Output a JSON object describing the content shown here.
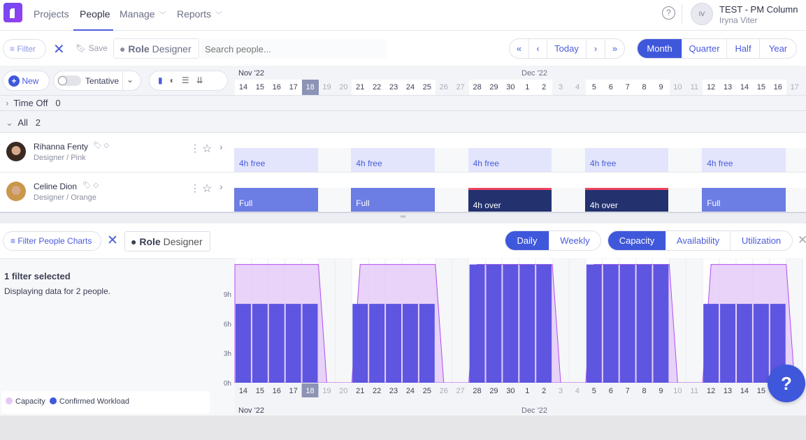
{
  "nav": {
    "items": [
      {
        "label": "Projects"
      },
      {
        "label": "People"
      },
      {
        "label": "Manage"
      },
      {
        "label": "Reports"
      }
    ],
    "active": "People"
  },
  "account": {
    "initials": "IV",
    "workspace": "TEST - PM Column",
    "user": "Iryna Viter",
    "help": "?"
  },
  "filterbar": {
    "filter_label": "Filter",
    "save_label": "Save",
    "chip_key": "Role",
    "chip_value": "Designer",
    "search_placeholder": "Search people..."
  },
  "datenav": {
    "today": "Today",
    "first": "«",
    "prev": "‹",
    "next": "›",
    "last": "»"
  },
  "views": {
    "items": [
      "Month",
      "Quarter",
      "Half",
      "Year"
    ],
    "active": "Month"
  },
  "toolbar": {
    "new_label": "New",
    "tentative_label": "Tentative"
  },
  "timeline": {
    "months": [
      "Nov '22",
      "Dec '22"
    ],
    "days": [
      14,
      15,
      16,
      17,
      18,
      19,
      20,
      21,
      22,
      23,
      24,
      25,
      26,
      27,
      28,
      29,
      30,
      1,
      2,
      3,
      4,
      5,
      6,
      7,
      8,
      9,
      10,
      11,
      12,
      13,
      14,
      15,
      16,
      17
    ],
    "weekend": [
      19,
      20,
      26,
      27,
      3,
      4,
      10,
      11,
      17
    ],
    "today": 18
  },
  "groups": [
    {
      "label": "Time Off",
      "count": "0"
    },
    {
      "label": "All",
      "count": "2"
    }
  ],
  "people": [
    {
      "name": "Rihanna Fenty",
      "role": "Designer / Pink",
      "allocations": [
        {
          "label": "4h free",
          "kind": "free"
        },
        {
          "label": "4h free",
          "kind": "free"
        },
        {
          "label": "4h free",
          "kind": "free"
        },
        {
          "label": "4h free",
          "kind": "free"
        },
        {
          "label": "4h free",
          "kind": "free"
        }
      ]
    },
    {
      "name": "Celine Dion",
      "role": "Designer / Orange",
      "allocations": [
        {
          "label": "Full",
          "kind": "full"
        },
        {
          "label": "Full",
          "kind": "full"
        },
        {
          "label": "4h over",
          "kind": "over"
        },
        {
          "label": "4h over",
          "kind": "over"
        },
        {
          "label": "Full",
          "kind": "full"
        }
      ]
    }
  ],
  "charts": {
    "filter_label": "Filter People Charts",
    "chip_key": "Role",
    "chip_value": "Designer",
    "period": {
      "items": [
        "Daily",
        "Weekly"
      ],
      "active": "Daily"
    },
    "mode": {
      "items": [
        "Capacity",
        "Availability",
        "Utilization"
      ],
      "active": "Capacity"
    },
    "summary_title": "1 filter selected",
    "summary_text": "Displaying data for 2 people."
  },
  "chart_data": {
    "type": "bar",
    "categories": [
      "14",
      "15",
      "16",
      "17",
      "18",
      "19",
      "20",
      "21",
      "22",
      "23",
      "24",
      "25",
      "26",
      "27",
      "28",
      "29",
      "30",
      "1",
      "2",
      "3",
      "4",
      "5",
      "6",
      "7",
      "8",
      "9",
      "10",
      "11",
      "12",
      "13",
      "14",
      "15",
      "16",
      "17"
    ],
    "series": [
      {
        "name": "Capacity",
        "type": "area",
        "color": "#e3c8f7",
        "values": [
          12,
          12,
          12,
          12,
          12,
          0,
          0,
          12,
          12,
          12,
          12,
          12,
          0,
          0,
          12,
          12,
          12,
          12,
          12,
          0,
          0,
          12,
          12,
          12,
          12,
          12,
          0,
          0,
          12,
          12,
          12,
          12,
          12,
          0
        ]
      },
      {
        "name": "Confirmed Workload",
        "type": "bar",
        "color": "#5e55e0",
        "values": [
          8,
          8,
          8,
          8,
          8,
          0,
          0,
          8,
          8,
          8,
          8,
          8,
          0,
          0,
          12,
          12,
          12,
          12,
          12,
          0,
          0,
          12,
          12,
          12,
          12,
          12,
          0,
          0,
          8,
          8,
          8,
          8,
          8,
          0
        ]
      }
    ],
    "yticks": [
      "0h",
      "3h",
      "6h",
      "9h"
    ],
    "ylim": [
      0,
      13
    ]
  }
}
